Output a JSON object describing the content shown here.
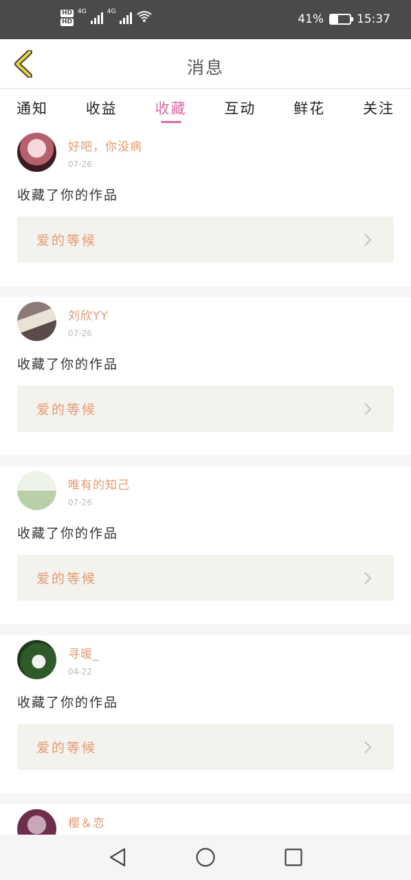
{
  "status_bar": {
    "hd1": "HD",
    "hd2": "HD",
    "signal1": "4G",
    "signal2": "4G",
    "battery_text": "41%",
    "battery_level": 0.41,
    "time": "15:37"
  },
  "header": {
    "title": "消息",
    "back_icon": "chevron-left-icon"
  },
  "tabs": [
    {
      "label": "通知",
      "active": false
    },
    {
      "label": "收益",
      "active": false
    },
    {
      "label": "收藏",
      "active": true
    },
    {
      "label": "互动",
      "active": false
    },
    {
      "label": "鲜花",
      "active": false
    },
    {
      "label": "关注",
      "active": false
    }
  ],
  "colors": {
    "accent": "#d86aa6",
    "username": "#e39a72",
    "work_box_bg": "#f3f2ec"
  },
  "notifications": [
    {
      "username": "好吧，你没病",
      "date": "07-26",
      "action": "收藏了你的作品",
      "work_title": "爱的等候"
    },
    {
      "username": "刘欣YY",
      "date": "07-26",
      "action": "收藏了你的作品",
      "work_title": "爱的等候"
    },
    {
      "username": "唯有的知己",
      "date": "07-26",
      "action": "收藏了你的作品",
      "work_title": "爱的等候"
    },
    {
      "username": "寻暖_",
      "date": "04-22",
      "action": "收藏了你的作品",
      "work_title": "爱的等候"
    },
    {
      "username": "樱＆恋"
    }
  ],
  "nav": {
    "back": "triangle-back-icon",
    "home": "circle-home-icon",
    "recents": "square-recents-icon"
  }
}
